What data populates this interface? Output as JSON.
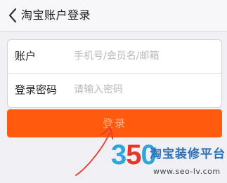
{
  "header": {
    "title": "淘宝账户登录",
    "back_icon": "chevron-left-icon"
  },
  "form": {
    "account": {
      "label": "账户",
      "placeholder": "手机号/会员名/邮箱",
      "value": ""
    },
    "password": {
      "label": "登录密码",
      "placeholder": "请输入密码",
      "value": ""
    }
  },
  "login_button": {
    "label": "登录"
  },
  "watermark": {
    "digits": [
      "3",
      "5",
      "0"
    ],
    "text": "淘宝装修平台",
    "url": "www.seo-lv.com",
    "colors": {
      "three": "#2fa5dc",
      "five": "#e8352a",
      "zero": "#2fa5dc",
      "text": "#2d6fb4"
    }
  },
  "annotation": {
    "color": "#e83a2e",
    "icon": "red-arrow-scribble"
  },
  "colors": {
    "accent": "#ff5a0d",
    "background": "#f0eff4"
  }
}
